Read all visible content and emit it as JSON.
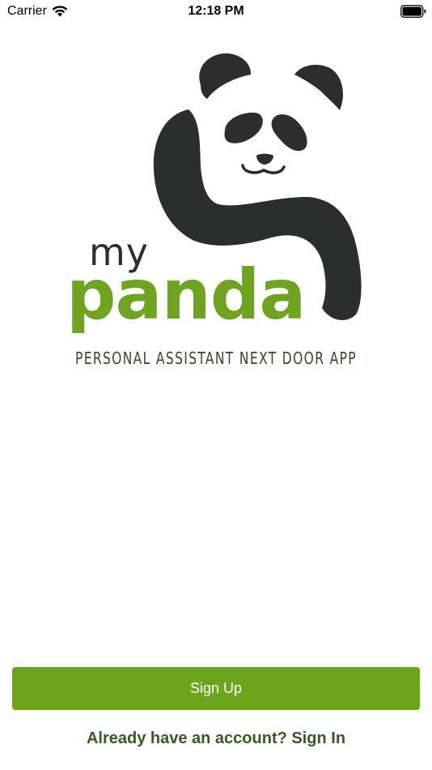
{
  "status_bar": {
    "carrier": "Carrier",
    "time": "12:18 PM",
    "wifi_icon": "wifi-icon",
    "battery_icon": "battery-icon"
  },
  "logo": {
    "line1": "my",
    "line2": "panda",
    "tagline": "PERSONAL ASSISTANT NEXT DOOR APP",
    "colors": {
      "dark": "#2b2e2c",
      "green": "#6ea41f",
      "tagline": "#2d4a22"
    }
  },
  "actions": {
    "signup_label": "Sign Up",
    "signin_label": "Already have an account? Sign In",
    "signup_color": "#6aa51c",
    "signin_color": "#355a24"
  }
}
